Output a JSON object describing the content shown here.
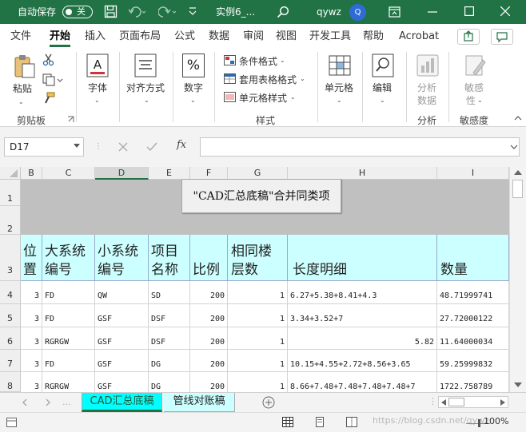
{
  "titlebar": {
    "autosave_label": "自动保存",
    "autosave_state": "关",
    "filename": "实例6_...",
    "user": "qywz",
    "avatar_initial": "Q"
  },
  "tabs": [
    "文件",
    "开始",
    "插入",
    "页面布局",
    "公式",
    "数据",
    "审阅",
    "视图",
    "开发工具",
    "帮助",
    "Acrobat"
  ],
  "active_tab": "开始",
  "ribbon": {
    "paste": "粘贴",
    "clipboard_group": "剪贴板",
    "font": "字体",
    "align": "对齐方式",
    "number": "数字",
    "number_icon": "%",
    "conditional_format": "条件格式",
    "table_format": "套用表格格式",
    "cell_style": "单元格样式",
    "styles_group": "样式",
    "cells": "单元格",
    "editing": "编辑",
    "analyze_line1": "分析",
    "analyze_line2": "数据",
    "analyze_group": "分析",
    "sensitivity_line1": "敏感",
    "sensitivity_line2": "性",
    "sensitivity_group": "敏感度"
  },
  "formula_bar": {
    "name_box": "D17",
    "formula": "",
    "fx": "fx"
  },
  "columns": [
    "B",
    "C",
    "D",
    "E",
    "F",
    "G",
    "H",
    "I"
  ],
  "selected_column": "D",
  "row_numbers": [
    "1",
    "2",
    "3",
    "4",
    "5",
    "6",
    "7",
    "8"
  ],
  "button_label": "\"CAD汇总底稿\"合并同类项",
  "headers": [
    [
      "位",
      "置"
    ],
    [
      "大系统",
      "编号"
    ],
    [
      "小系统",
      "编号"
    ],
    [
      "项目",
      "名称"
    ],
    [
      "",
      "比例"
    ],
    [
      "相同楼",
      "层数"
    ],
    [
      "",
      "长度明细"
    ],
    [
      "",
      "数量"
    ]
  ],
  "rows": [
    [
      "3",
      "FD",
      "QW",
      "SD",
      "200",
      "1",
      "6.27+5.38+8.41+4.3",
      "48.71999741"
    ],
    [
      "3",
      "FD",
      "GSF",
      "DSF",
      "200",
      "1",
      "3.34+3.52+7",
      "27.72000122"
    ],
    [
      "3",
      "RGRGW",
      "GSF",
      "DSF",
      "200",
      "1",
      "5.82",
      "11.64000034"
    ],
    [
      "3",
      "FD",
      "GSF",
      "DG",
      "200",
      "1",
      "10.15+4.55+2.72+8.56+3.65",
      "59.25999832"
    ],
    [
      "3",
      "RGRGW",
      "GSF",
      "DG",
      "200",
      "1",
      "8.66+7.48+7.48+7.48+7.48+7",
      "1722.758789"
    ]
  ],
  "sheets": [
    "CAD汇总底稿",
    "管线对账稿"
  ],
  "active_sheet": "CAD汇总底稿",
  "status": {
    "zoom": "100%",
    "watermark": "https://blog.csdn.net/qywz"
  },
  "colors": {
    "excel_green": "#217346",
    "header_fill": "#ccffff",
    "gray_band": "#c0c0c0",
    "active_sheet_tab": "#00ffff"
  }
}
